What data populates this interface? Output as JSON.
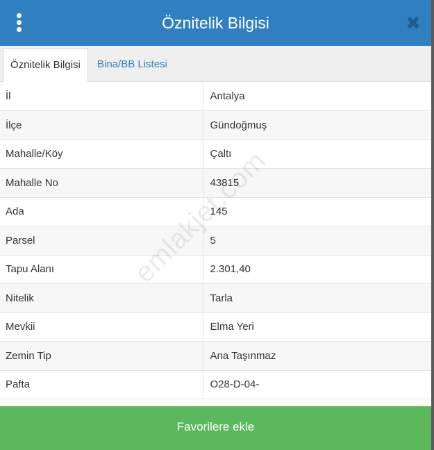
{
  "header": {
    "title": "Öznitelik Bilgisi",
    "menu_icon": "more-vertical-icon",
    "close_icon": "close-icon",
    "close_glyph": "✖"
  },
  "tabs": [
    {
      "label": "Öznitelik Bilgisi",
      "active": true
    },
    {
      "label": "Bina/BB Listesi",
      "active": false
    }
  ],
  "attributes": [
    {
      "key": "İl",
      "value": "Antalya"
    },
    {
      "key": "İlçe",
      "value": "Gündoğmuş"
    },
    {
      "key": "Mahalle/Köy",
      "value": "Çaltı"
    },
    {
      "key": "Mahalle No",
      "value": "43815"
    },
    {
      "key": "Ada",
      "value": "145"
    },
    {
      "key": "Parsel",
      "value": "5"
    },
    {
      "key": "Tapu Alanı",
      "value": "2.301,40"
    },
    {
      "key": "Nitelik",
      "value": "Tarla"
    },
    {
      "key": "Mevkii",
      "value": "Elma Yeri"
    },
    {
      "key": "Zemin Tip",
      "value": "Ana Taşınmaz"
    },
    {
      "key": "Pafta",
      "value": "O28-D-04-"
    }
  ],
  "watermark": "emlakjet.com",
  "footer": {
    "button_label": "Favorilere ekle"
  },
  "colors": {
    "header_bg": "#2f7fc1",
    "footer_bg": "#5cb85c",
    "tab_link": "#2f7fc1"
  }
}
